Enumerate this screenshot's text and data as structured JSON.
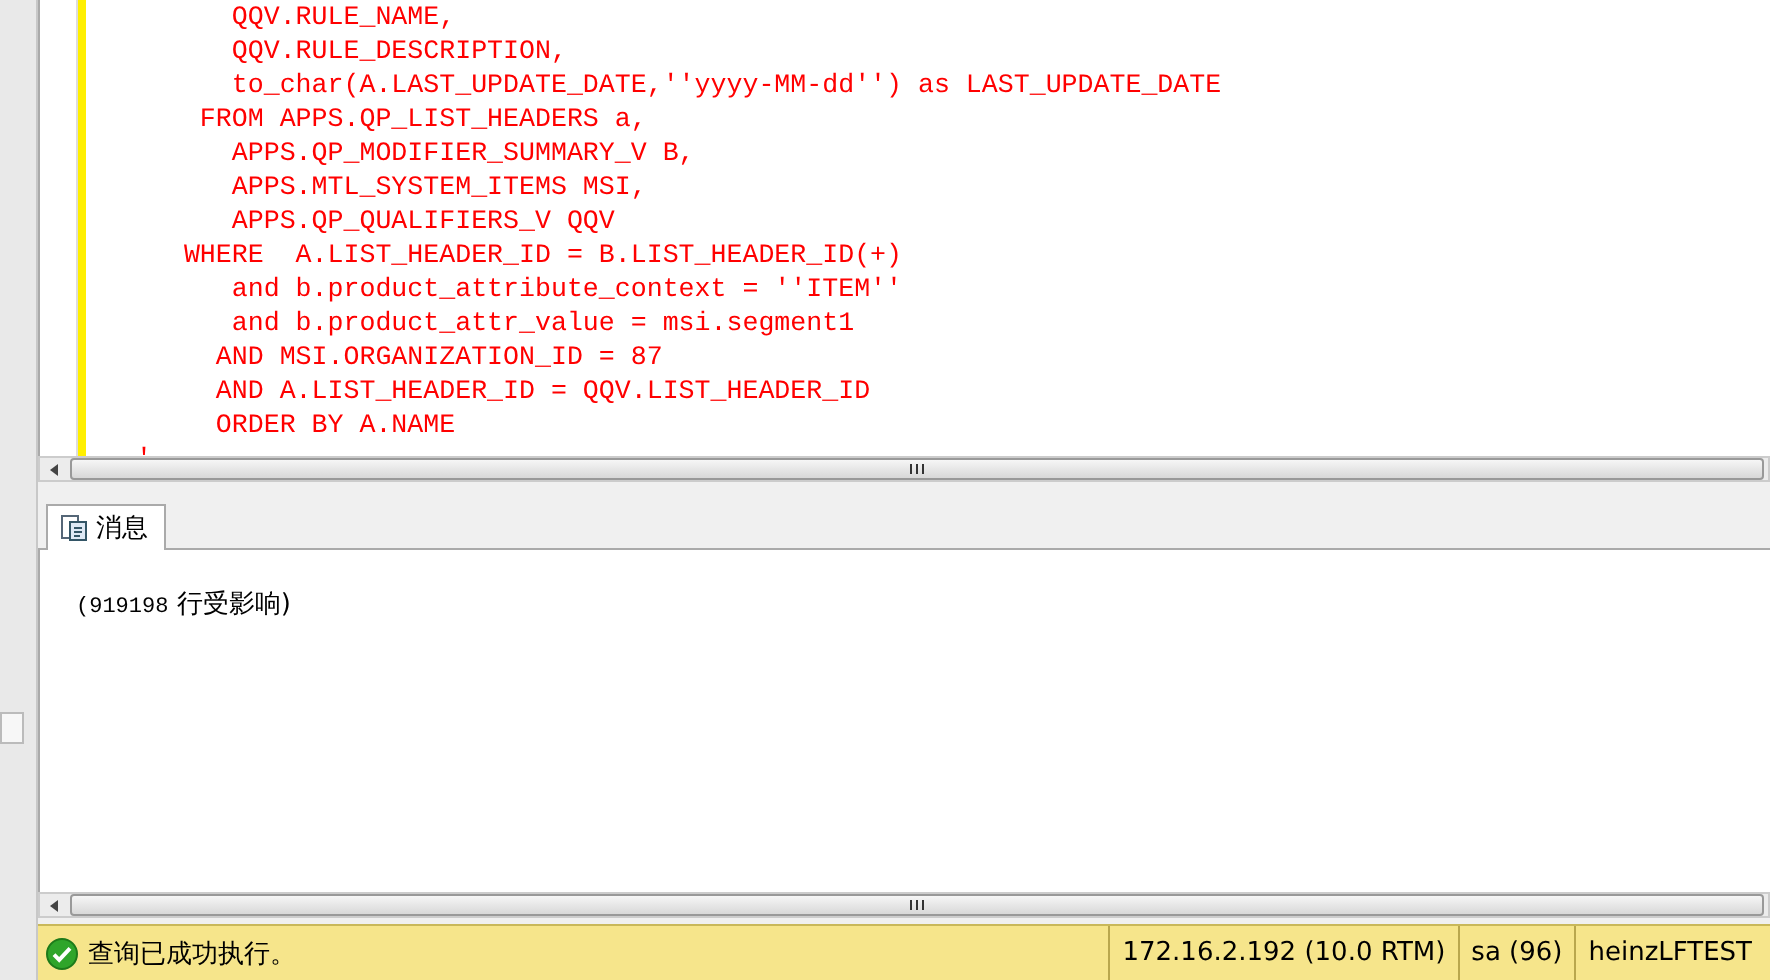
{
  "editor": {
    "lines": [
      "      QQV.RULE_NAME,",
      "      QQV.RULE_DESCRIPTION,",
      "      to_char(A.LAST_UPDATE_DATE,''yyyy-MM-dd'') as LAST_UPDATE_DATE",
      "    FROM APPS.QP_LIST_HEADERS a,",
      "      APPS.QP_MODIFIER_SUMMARY_V B,",
      "      APPS.MTL_SYSTEM_ITEMS MSI,",
      "      APPS.QP_QUALIFIERS_V QQV",
      "   WHERE  A.LIST_HEADER_ID = B.LIST_HEADER_ID(+)",
      "      and b.product_attribute_context = ''ITEM''",
      "      and b.product_attr_value = msi.segment1",
      "     AND MSI.ORGANIZATION_ID = 87",
      "     AND A.LIST_HEADER_ID = QQV.LIST_HEADER_ID",
      "     ORDER BY A.NAME",
      "'"
    ]
  },
  "tabs": [
    {
      "label": "消息",
      "selected": true
    }
  ],
  "messages": {
    "count": "(919198",
    "text": "行受影响)"
  },
  "status_bar": {
    "message": "查询已成功执行。",
    "server": "172.16.2.192 (10.0 RTM)",
    "user": "sa (96)",
    "database": "heinzLFTEST"
  }
}
